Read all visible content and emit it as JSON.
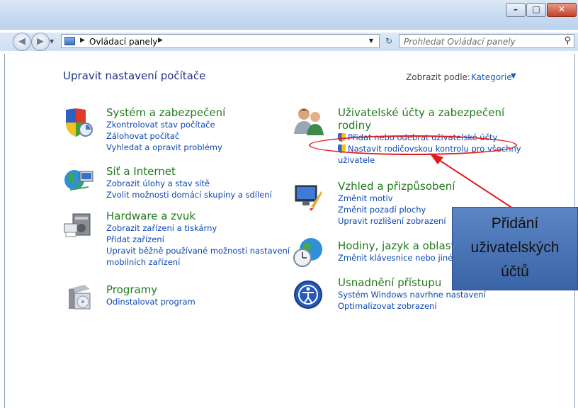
{
  "window": {
    "minimize_label": "–",
    "maximize_label": "□",
    "close_label": "✕"
  },
  "nav": {
    "back_icon": "back-arrow-icon",
    "forward_icon": "forward-arrow-icon",
    "address": {
      "sep1": "▶",
      "location": "Ovládací panely",
      "sep2": "▶"
    },
    "search": {
      "placeholder": "Prohledat Ovládací panely"
    }
  },
  "main": {
    "title": "Upravit nastavení počítače",
    "view_by_label": "Zobrazit podle:",
    "view_by_value": "Kategorie"
  },
  "categories_left": [
    {
      "title": "Systém a zabezpečení",
      "icon": "system-security-icon",
      "links": [
        "Zkontrolovat stav počítače",
        "Zálohovat počítač",
        "Vyhledat a opravit problémy"
      ]
    },
    {
      "title": "Síť a Internet",
      "icon": "network-internet-icon",
      "links": [
        "Zobrazit úlohy a stav sítě",
        "Zvolit možnosti domácí skupiny a sdílení"
      ]
    },
    {
      "title": "Hardware a zvuk",
      "icon": "hardware-sound-icon",
      "links": [
        "Zobrazit zařízení a tiskárny",
        "Přidat zařízení",
        "Upravit běžně používané možnosti nastavení",
        "mobilních zařízení"
      ]
    },
    {
      "title": "Programy",
      "icon": "programs-icon",
      "links": [
        "Odinstalovat program"
      ]
    }
  ],
  "categories_right": [
    {
      "title_line1": "Uživatelské účty a zabezpečení",
      "title_line2": "rodiny",
      "icon": "user-accounts-icon",
      "links": [
        "Přidat nebo odebrat uživatelské účty",
        "Nastavit rodičovskou kontrolu pro všechny",
        "uživatele"
      ]
    },
    {
      "title": "Vzhled a přizpůsobení",
      "icon": "appearance-icon",
      "links": [
        "Změnit motiv",
        "Změnit pozadí plochy",
        "Upravit rozlišení zobrazení"
      ]
    },
    {
      "title": "Hodiny, jazyk a oblast",
      "icon": "clock-language-region-icon",
      "links": [
        "Změnit klávesnice nebo jiné m"
      ]
    },
    {
      "title": "Usnadnění přístupu",
      "icon": "ease-of-access-icon",
      "links": [
        "Systém Windows navrhne nastavení",
        "Optimalizovat zobrazení"
      ]
    }
  ],
  "annotation": {
    "line1": "Přidání",
    "line2": "uživatelských",
    "line3": "účtů",
    "color": "#e21a1a",
    "box_color": "#4a74b8"
  }
}
